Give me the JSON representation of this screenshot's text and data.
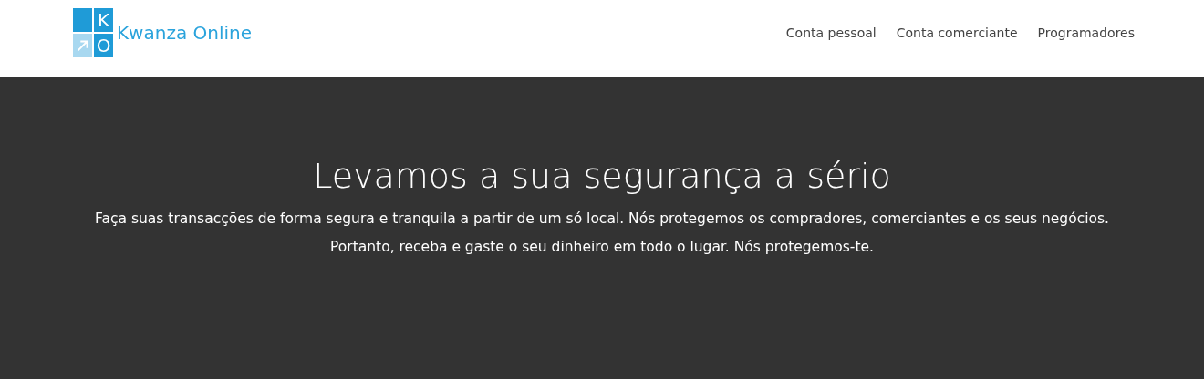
{
  "logo": {
    "letters": [
      "K",
      "O"
    ],
    "name": "Kwanza Online"
  },
  "nav": [
    "Conta pessoal",
    "Conta comerciante",
    "Programadores"
  ],
  "hero": {
    "title": "Levamos a sua segurança a sério",
    "lines": [
      "Faça suas transacções de forma segura e tranquila a partir de um só local. Nós protegemos os compradores, comerciantes e os seus negócios.",
      "Portanto, receba e gaste o seu dinheiro em todo o lugar. Nós protegemos-te."
    ]
  }
}
